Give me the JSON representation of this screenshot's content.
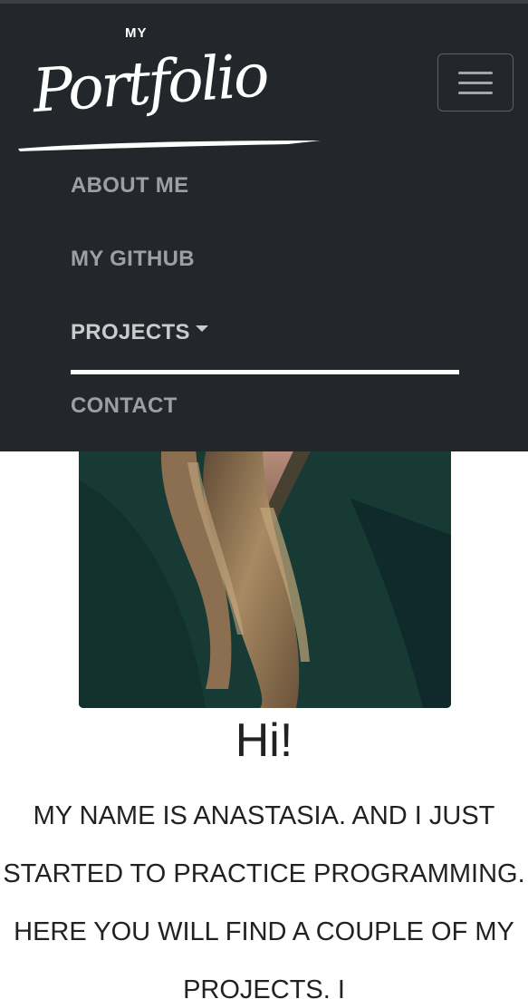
{
  "brand": {
    "small": "MY",
    "script": "Portfolio"
  },
  "nav": {
    "items": [
      {
        "label": "ABOUT ME"
      },
      {
        "label": "MY GITHUB"
      },
      {
        "label": "PROJECTS"
      },
      {
        "label": "CONTACT"
      }
    ]
  },
  "hero": {
    "greeting": "Hi!",
    "intro": "MY NAME IS ANASTASIA. AND I JUST STARTED TO PRACTICE PROGRAMMING. HERE YOU WILL FIND A COUPLE OF MY PROJECTS. I"
  },
  "colors": {
    "navbar_bg": "#23272b",
    "nav_link": "#9da0a3",
    "nav_active": "#c9cbcd",
    "underline": "#ffffff",
    "text": "#222222"
  }
}
